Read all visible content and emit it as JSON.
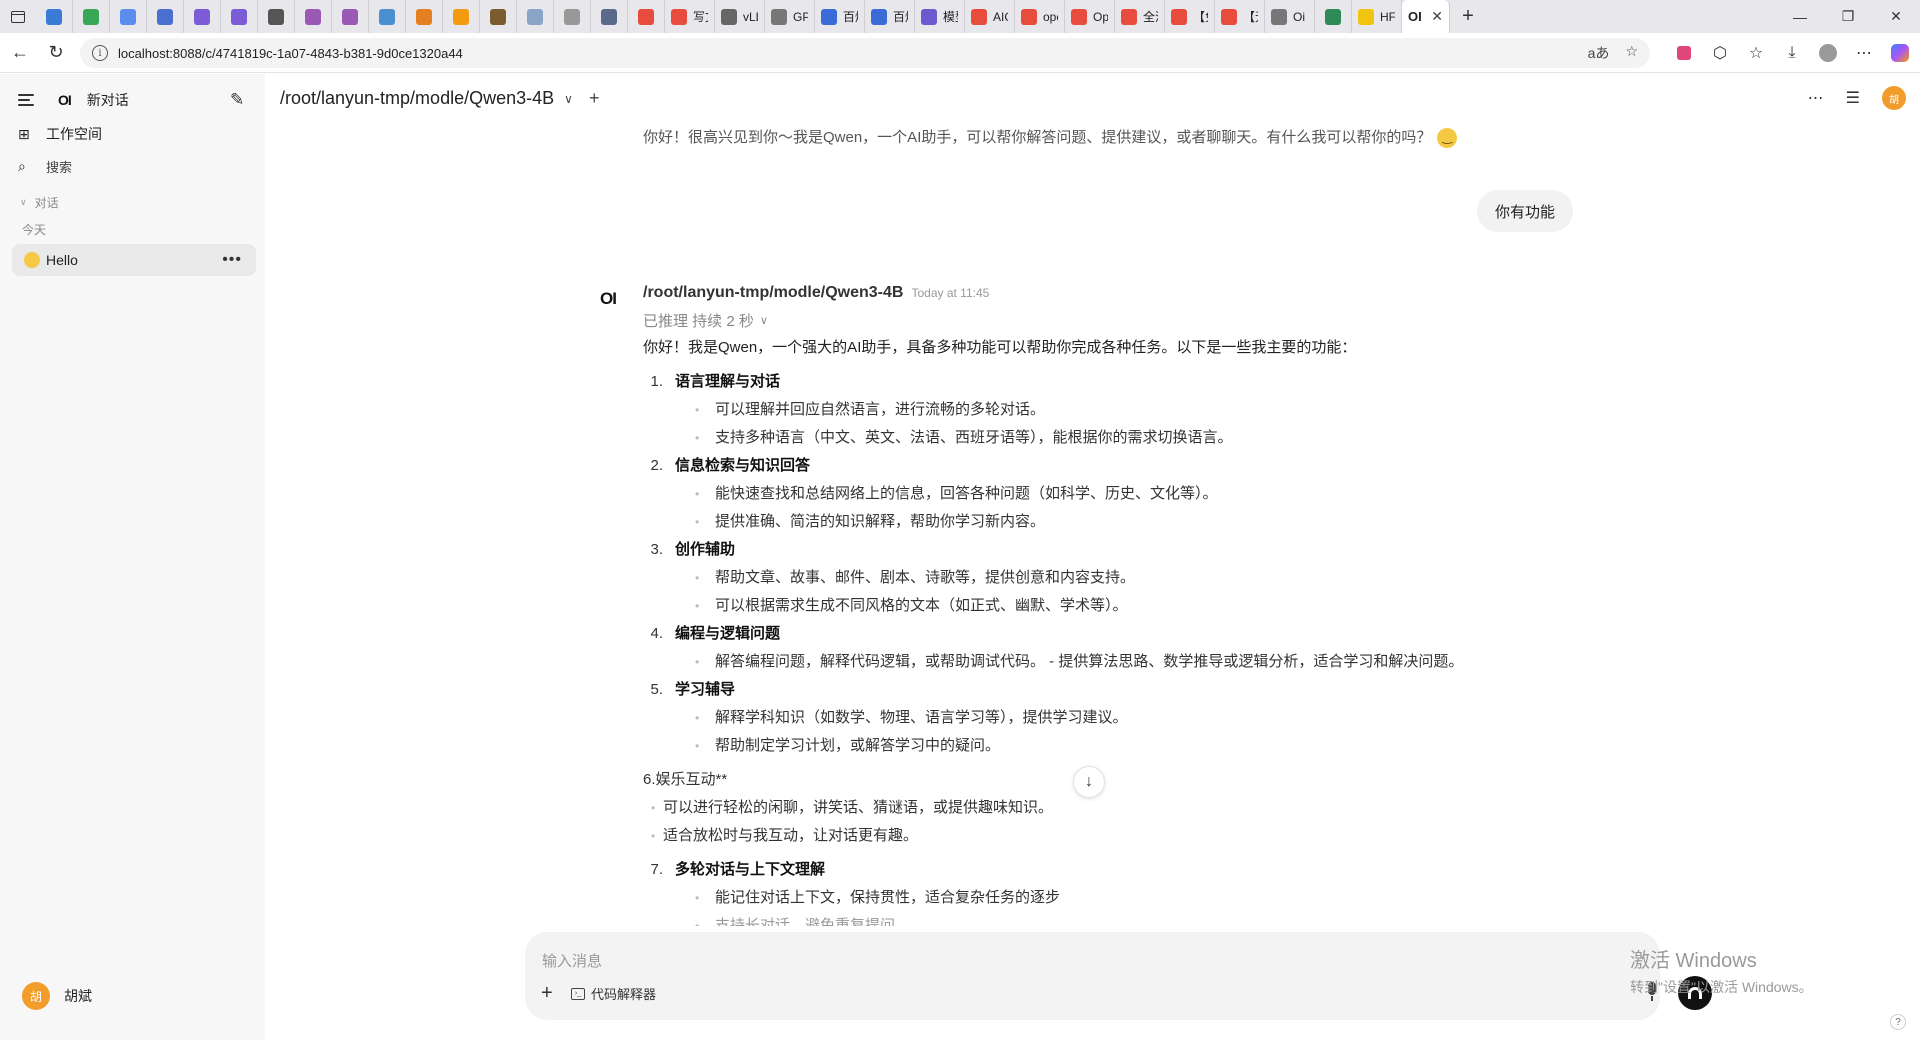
{
  "browser": {
    "tabs": [
      {
        "label": "",
        "color": "#3b7bd6"
      },
      {
        "label": "",
        "color": "#3aa757"
      },
      {
        "label": "",
        "color": "#5b8def"
      },
      {
        "label": "",
        "color": "#4a6fd0"
      },
      {
        "label": "",
        "color": "#7b5cd6"
      },
      {
        "label": "",
        "color": "#7b5cd6"
      },
      {
        "label": "",
        "color": "#555555"
      },
      {
        "label": "",
        "color": "#9b59b6"
      },
      {
        "label": "",
        "color": "#9b59b6"
      },
      {
        "label": "",
        "color": "#4a8fd0"
      },
      {
        "label": "",
        "color": "#e67e22"
      },
      {
        "label": "",
        "color": "#f39c12"
      },
      {
        "label": "",
        "color": "#7a5c2e"
      },
      {
        "label": "",
        "color": "#8aa4c8"
      },
      {
        "label": "",
        "color": "#999999"
      },
      {
        "label": "",
        "color": "#5a6a8a"
      },
      {
        "label": "",
        "color": "#e74c3c"
      },
      {
        "label": "写文",
        "color": "#e74c3c"
      },
      {
        "label": "vLLM",
        "color": "#666666"
      },
      {
        "label": "GPU",
        "color": "#777777"
      },
      {
        "label": "百炼",
        "color": "#3b6bd6"
      },
      {
        "label": "百炼",
        "color": "#3b6bd6"
      },
      {
        "label": "模型",
        "color": "#6a5acd"
      },
      {
        "label": "AIG(",
        "color": "#e74c3c"
      },
      {
        "label": "ope",
        "color": "#e74c3c"
      },
      {
        "label": "Ope",
        "color": "#e74c3c"
      },
      {
        "label": "全流",
        "color": "#e74c3c"
      },
      {
        "label": "【免",
        "color": "#e74c3c"
      },
      {
        "label": "【无",
        "color": "#e74c3c"
      },
      {
        "label": "Oi",
        "color": "#777777"
      },
      {
        "label": "",
        "color": "#2e8b57"
      },
      {
        "label": "HF-I",
        "color": "#f1c40f"
      }
    ],
    "active_tab": {
      "label": "OI",
      "close": "✕"
    },
    "new_tab": "+",
    "window_controls": {
      "minimize": "—",
      "restore": "❐",
      "close": "✕"
    },
    "nav": {
      "back": "←",
      "reload": "↻"
    },
    "url": "localhost:8088/c/4741819c-1a07-4843-b381-9d0ce1320a44",
    "url_actions": {
      "read_aloud": "aあ",
      "favorite": "☆"
    }
  },
  "sidebar": {
    "new_chat": "新对话",
    "workspace": "工作空间",
    "search": "搜索",
    "section_chats": "对话",
    "group_today": "今天",
    "chats": [
      {
        "title": "Hello",
        "more": "•••"
      }
    ],
    "user": {
      "avatar": "胡",
      "name": "胡斌"
    }
  },
  "header": {
    "model": "/root/lanyun-tmp/modle/Qwen3-4B",
    "add_model": "+",
    "avatar": "胡"
  },
  "conversation": {
    "previous_assistant": "你好！很高兴见到你～我是Qwen，一个AI助手，可以帮你解答问题、提供建议，或者聊聊天。有什么我可以帮你的吗？",
    "user_message": "你有功能",
    "assistant": {
      "logo": "OI",
      "name": "/root/lanyun-tmp/modle/Qwen3-4B",
      "time": "Today at 11:45",
      "reasoning": "已推理 持续 2 秒",
      "intro": "你好！我是Qwen，一个强大的AI助手，具备多种功能可以帮助你完成各种任务。以下是一些我主要的功能：",
      "sections": [
        {
          "num": "1.",
          "title": "语言理解与对话",
          "bullets": [
            "可以理解并回应自然语言，进行流畅的多轮对话。",
            "支持多种语言（中文、英文、法语、西班牙语等），能根据你的需求切换语言。"
          ]
        },
        {
          "num": "2.",
          "title": "信息检索与知识回答",
          "bullets": [
            "能快速查找和总结网络上的信息，回答各种问题（如科学、历史、文化等）。",
            "提供准确、简洁的知识解释，帮助你学习新内容。"
          ]
        },
        {
          "num": "3.",
          "title": "创作辅助",
          "bullets": [
            "帮助文章、故事、邮件、剧本、诗歌等，提供创意和内容支持。",
            "可以根据需求生成不同风格的文本（如正式、幽默、学术等）。"
          ]
        },
        {
          "num": "4.",
          "title": "编程与逻辑问题",
          "bullets": [
            "解答编程问题，解释代码逻辑，或帮助调试代码。 - 提供算法思路、数学推导或逻辑分析，适合学习和解决问题。"
          ]
        },
        {
          "num": "5.",
          "title": "学习辅导",
          "bullets": [
            "解释学科知识（如数学、物理、语言学习等），提供学习建议。",
            "帮助制定学习计划，或解答学习中的疑问。"
          ]
        }
      ],
      "section6_head": "6.娱乐互动**",
      "section6_bullets": [
        "可以进行轻松的闲聊，讲笑话、猜谜语，或提供趣味知识。",
        "适合放松时与我互动，让对话更有趣。"
      ],
      "section7": {
        "num": "7.",
        "title": "多轮对话与上下文理解",
        "bullets": [
          "能记住对话上下文，保持贯性，适合复杂任务的逐步",
          "支持长对话，避免重复提问。"
        ]
      }
    }
  },
  "composer": {
    "placeholder": "输入消息",
    "tool_label": "代码解释器"
  },
  "watermark": {
    "line1": "激活 Windows",
    "line2": "转到\"设置\"以激活 Windows。"
  },
  "help": "?"
}
